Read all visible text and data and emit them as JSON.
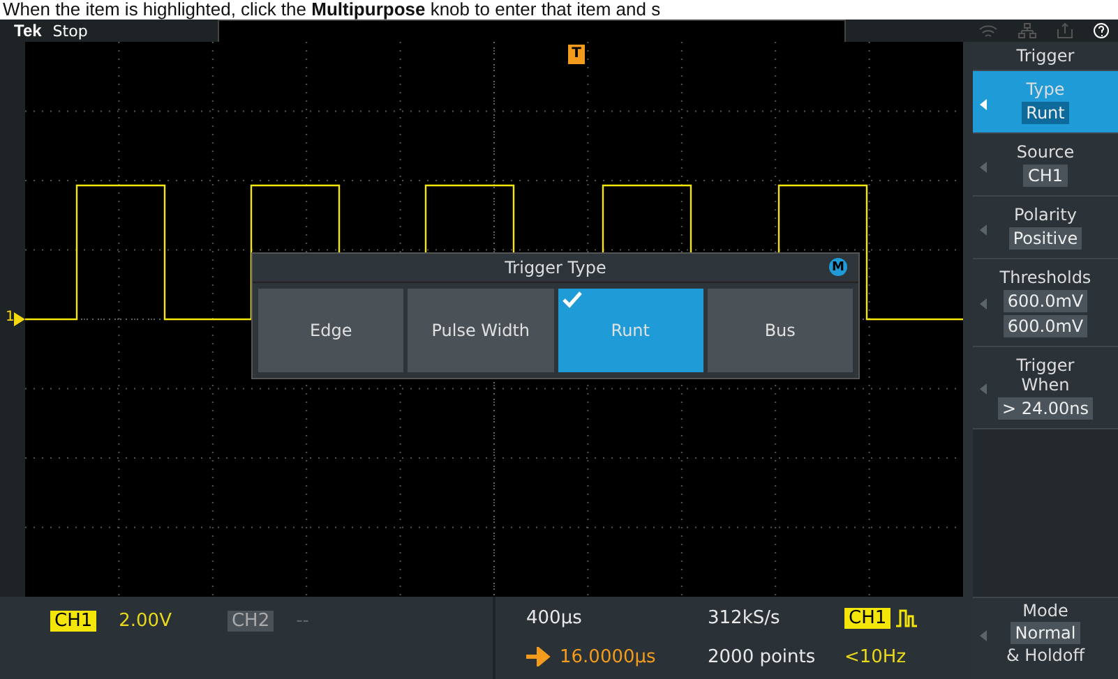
{
  "caption": "When the item is highlighted, click the **Multipurpose** knob to enter that item and s",
  "top_bar": {
    "logo": "Tek",
    "status": "Stop"
  },
  "trigger_dialog": {
    "title": "Trigger Type",
    "badge": "M",
    "options": [
      {
        "label": "Edge",
        "selected": false
      },
      {
        "label": "Pulse Width",
        "selected": false
      },
      {
        "label": "Runt",
        "selected": true
      },
      {
        "label": "Bus",
        "selected": false
      }
    ]
  },
  "channel_marker": "1",
  "trigger_marker": "T",
  "side_menu": {
    "title": "Trigger",
    "items": [
      {
        "label": "Type",
        "values": [
          "Runt"
        ],
        "selected": true
      },
      {
        "label": "Source",
        "values": [
          "CH1"
        ],
        "selected": false
      },
      {
        "label": "Polarity",
        "values": [
          "Positive"
        ],
        "selected": false
      },
      {
        "label": "Thresholds",
        "values": [
          "600.0mV",
          "600.0mV"
        ],
        "selected": false
      },
      {
        "label": "Trigger When",
        "values": [
          "> 24.00ns"
        ],
        "selected": false
      }
    ],
    "bottom_item": {
      "label": "Mode",
      "values": [
        "Normal"
      ],
      "footer": "& Holdoff",
      "selected": false
    }
  },
  "status_bar": {
    "ch1": {
      "badge": "CH1",
      "scale": "2.00V"
    },
    "ch2": {
      "badge": "CH2",
      "scale": "--"
    },
    "horizontal_scale": "400µs",
    "sample_rate": "312kS/s",
    "trigger_source": "CH1",
    "position": "16.0000µs",
    "record_length": "2000 points",
    "frequency": "<10Hz"
  }
}
